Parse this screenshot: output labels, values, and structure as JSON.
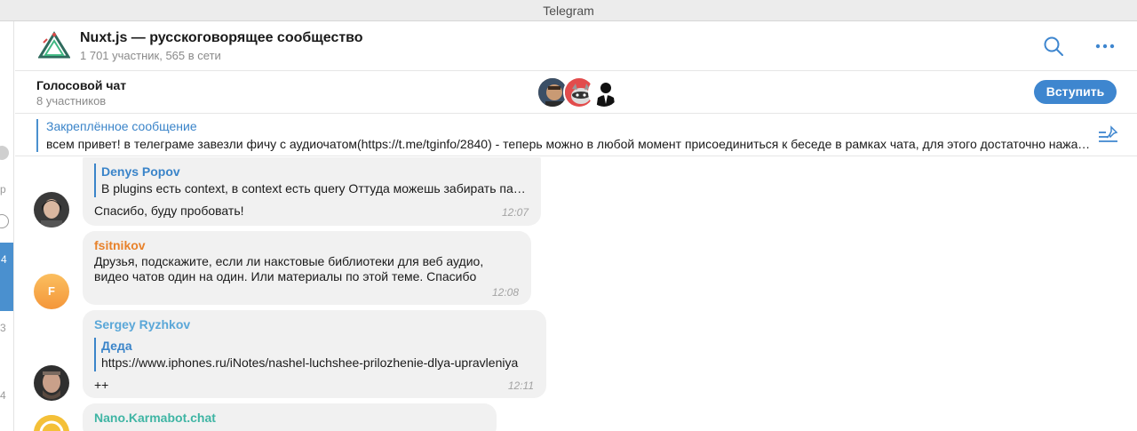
{
  "window": {
    "title": "Telegram"
  },
  "left_strip": {
    "fragments": [
      "р",
      "4",
      "3",
      "4"
    ]
  },
  "header": {
    "title": "Nuxt.js — русскоговорящее сообщество",
    "subtitle": "1 701 участник, 565 в сети",
    "icons": [
      "nuxt-logo-icon",
      "search-icon",
      "more-icon"
    ]
  },
  "voice_chat": {
    "title": "Голосовой чат",
    "participants": "8 участников",
    "join_label": "Вступить"
  },
  "pinned": {
    "label": "Закреплённое сообщение",
    "text": "всем привет! в телеграме завезли фичу с аудиочатом(https://t.me/tginfo/2840) - теперь можно в любой момент присоединиться к беседе в рамках чата, для этого достаточно нажать на кнопку"
  },
  "messages": [
    {
      "reply_name": "Denys Popov",
      "reply_text": "В plugins есть context, в context есть query Оттуда можешь забирать параметры",
      "text": "Спасибо, буду пробовать!",
      "time": "12:07"
    },
    {
      "author": "fsitnikov",
      "author_color": "#e8822b",
      "avatar_letter": "F",
      "text_lines": [
        "Друзья, подскажите, если ли накстовые библиотеки для веб аудио,",
        "видео чатов один на один. Или материалы по этой теме. Спасибо"
      ],
      "time": "12:08"
    },
    {
      "author": "Sergey Ryzhkov",
      "author_color": "#5aa7d8",
      "reply_name": "Деда",
      "reply_text": "https://www.iphones.ru/iNotes/nashel-luchshee-prilozhenie-dlya-upravleniya",
      "text": "++",
      "time": "12:11"
    },
    {
      "author": "Nano.Karmabot.chat",
      "author_color": "#3fb5a4"
    }
  ],
  "colors": {
    "accent": "#3e86cf",
    "bubble": "#f1f1f1"
  }
}
